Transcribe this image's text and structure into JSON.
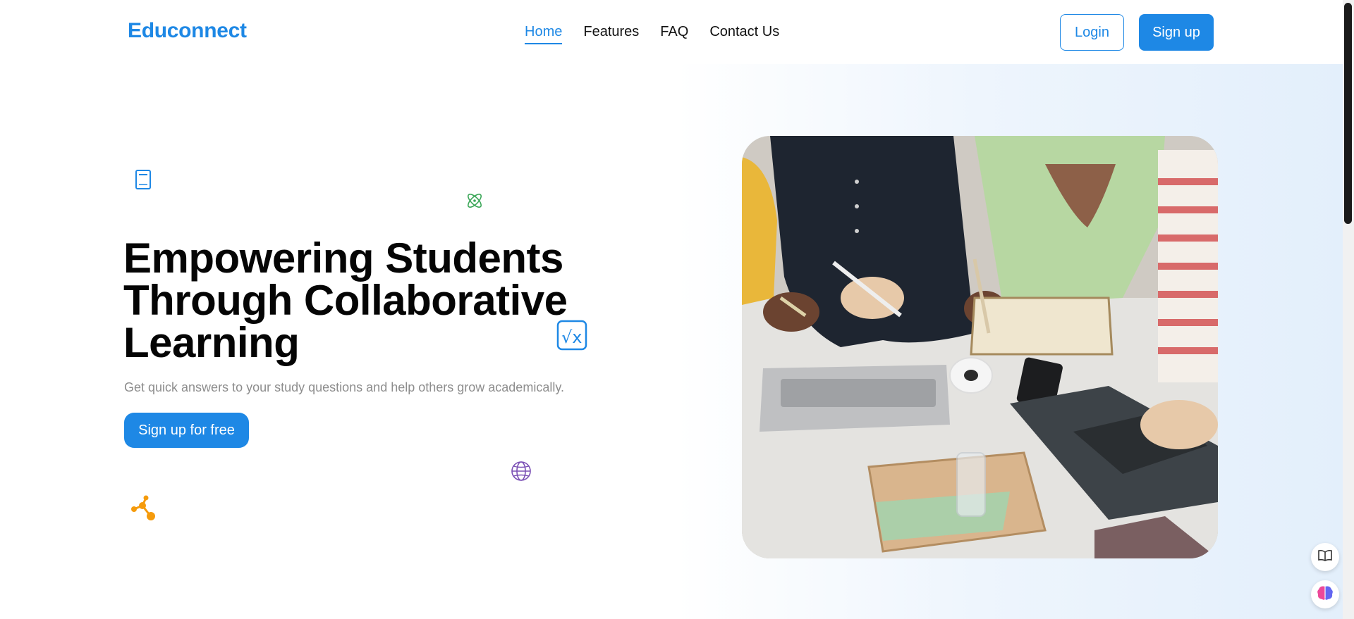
{
  "brand": {
    "name": "Educonnect",
    "accent": "#1e88e5"
  },
  "nav": {
    "items": [
      {
        "label": "Home",
        "active": true
      },
      {
        "label": "Features",
        "active": false
      },
      {
        "label": "FAQ",
        "active": false
      },
      {
        "label": "Contact Us",
        "active": false
      }
    ],
    "login_label": "Login",
    "signup_label": "Sign up"
  },
  "hero": {
    "title_lines": [
      "Empowering Students",
      "Through Collaborative",
      "Learning"
    ],
    "subtitle": "Get quick answers to your study questions and help others grow academically.",
    "cta_label": "Sign up for free",
    "image": "students-studying-together-photo"
  },
  "decor_icons": [
    "book-icon",
    "atom-icon",
    "square-root-icon",
    "globe-icon",
    "molecule-icon"
  ],
  "floating_buttons": [
    "book-open-icon",
    "brain-icon"
  ]
}
